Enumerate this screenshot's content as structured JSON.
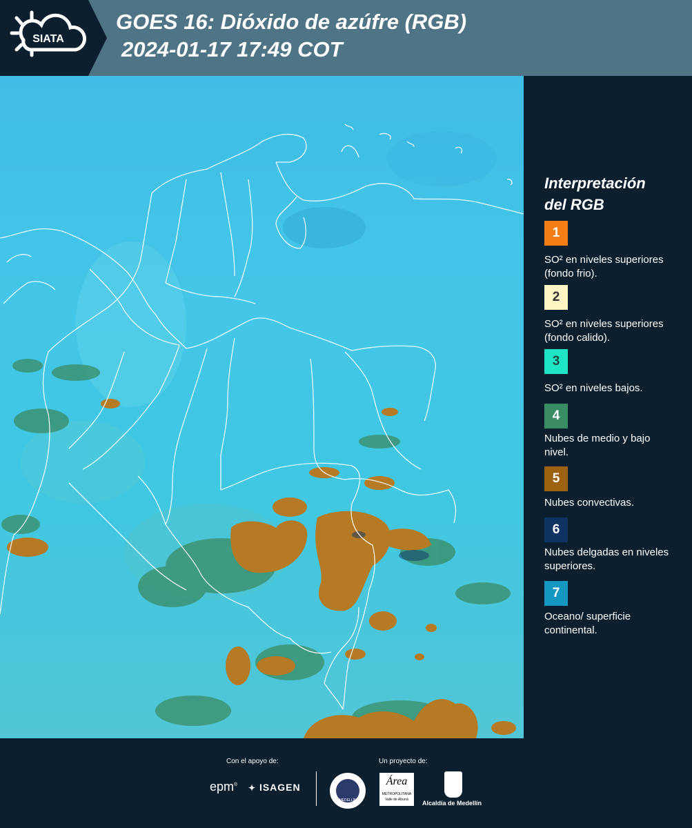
{
  "header": {
    "logo_text": "SIATA",
    "title_line1": "GOES 16: Dióxido de azúfre (RGB)",
    "title_line2": "2024-01-17 17:49 COT"
  },
  "legend": {
    "title_line1": "Interpretación",
    "title_line2": "del RGB",
    "items": [
      {
        "number": "1",
        "color": "#f47d14",
        "text_color": "#ffffff",
        "label": "SO² en niveles superiores (fondo frio)."
      },
      {
        "number": "2",
        "color": "#fdf5c4",
        "text_color": "#333333",
        "label": "SO² en niveles superiores (fondo calido)."
      },
      {
        "number": "3",
        "color": "#1ee6c4",
        "text_color": "#1a4a46",
        "label": "SO² en niveles bajos."
      },
      {
        "number": "4",
        "color": "#3a8c64",
        "text_color": "#ffffff",
        "label": "Nubes de medio y bajo nivel."
      },
      {
        "number": "5",
        "color": "#9c6210",
        "text_color": "#ffffff",
        "label": "Nubes convectivas."
      },
      {
        "number": "6",
        "color": "#0f3463",
        "text_color": "#ffffff",
        "label": "Nubes delgadas en niveles superiores."
      },
      {
        "number": "7",
        "color": "#1497c1",
        "text_color": "#ffffff",
        "label": "Oceano/ superficie continental."
      }
    ]
  },
  "footer": {
    "support_label": "Con el apoyo de:",
    "project_label": "Un proyecto de:",
    "epm": "epm",
    "isagen": "ISAGEN",
    "area_name": "Área",
    "area_sub1": "METROPOLITANA",
    "area_sub2": "Valle de Aburrá",
    "alcaldia": "Alcaldía de Medellín",
    "seal_text": "MEDELLÍN"
  }
}
